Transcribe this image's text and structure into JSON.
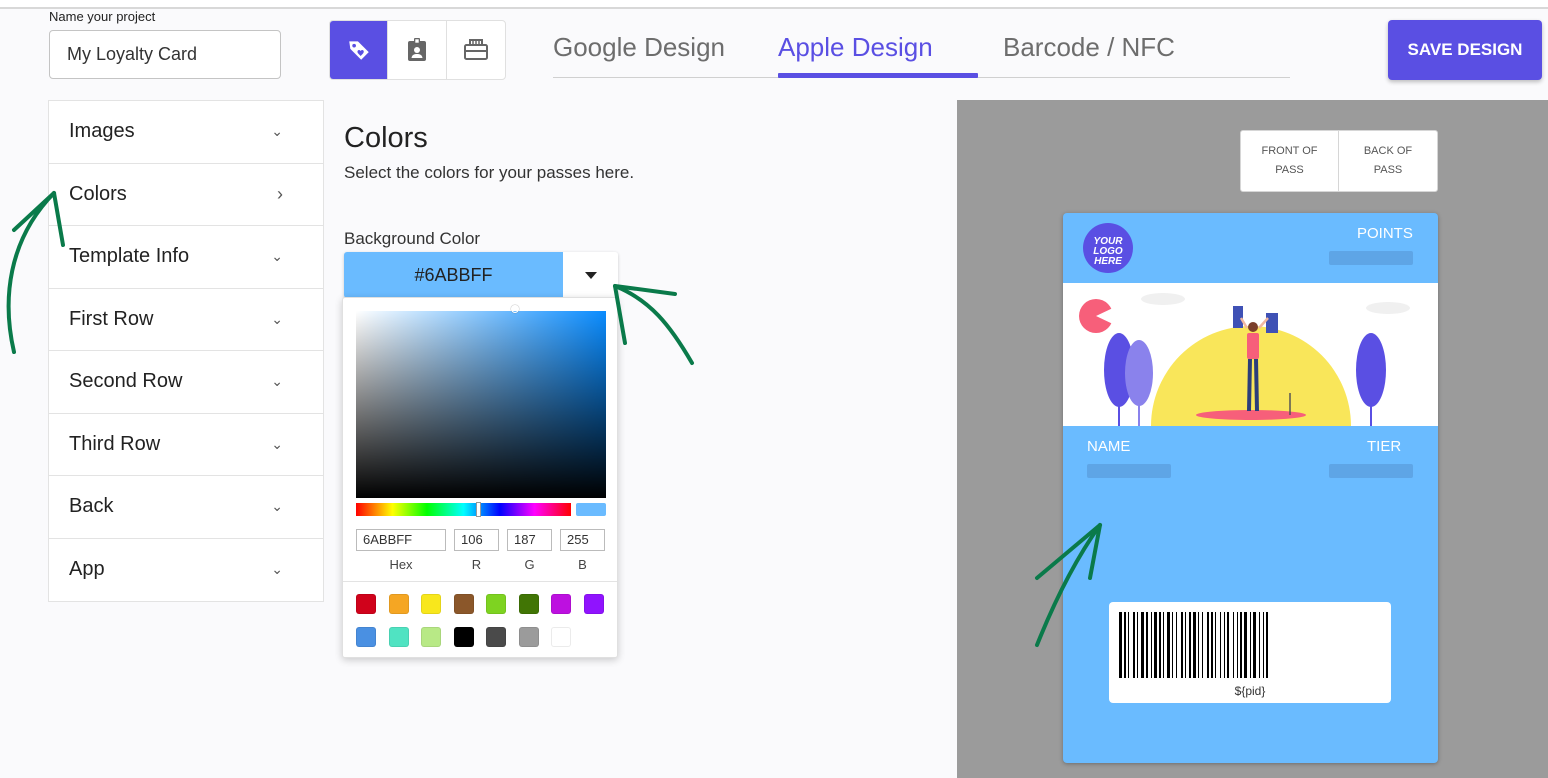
{
  "project": {
    "label": "Name your project",
    "value": "My Loyalty Card"
  },
  "icons": [
    {
      "name": "tag-icon",
      "active": true
    },
    {
      "name": "badge-icon",
      "active": false
    },
    {
      "name": "ticket-icon",
      "active": false
    }
  ],
  "tabs": [
    {
      "label": "Google Design",
      "active": false
    },
    {
      "label": "Apple Design",
      "active": true
    },
    {
      "label": "Barcode / NFC",
      "active": false
    }
  ],
  "save_label": "SAVE DESIGN",
  "sidebar": {
    "items": [
      {
        "label": "Images",
        "chevron": "down"
      },
      {
        "label": "Colors",
        "chevron": "right"
      },
      {
        "label": "Template Info",
        "chevron": "down"
      },
      {
        "label": "First Row",
        "chevron": "down"
      },
      {
        "label": "Second Row",
        "chevron": "down"
      },
      {
        "label": "Third Row",
        "chevron": "down"
      },
      {
        "label": "Back",
        "chevron": "down"
      },
      {
        "label": "App",
        "chevron": "down"
      }
    ]
  },
  "content": {
    "title": "Colors",
    "subtitle": "Select the colors for your passes here.",
    "field_label": "Background Color",
    "field_value": "#6ABBFF"
  },
  "picker": {
    "hex": "6ABBFF",
    "r": "106",
    "g": "187",
    "b": "255",
    "labels": {
      "hex": "Hex",
      "r": "R",
      "g": "G",
      "b": "B"
    },
    "swatches": [
      "#d0021b",
      "#f5a623",
      "#f8e71c",
      "#8b572a",
      "#7ed321",
      "#417505",
      "#bd10e0",
      "#9013fe",
      "#4a90e2",
      "#50e3c2",
      "#b8e986",
      "#000000",
      "#4a4a4a",
      "#9b9b9b",
      "#ffffff"
    ]
  },
  "preview": {
    "front_label": "FRONT OF PASS",
    "back_label": "BACK OF PASS",
    "logo_text": "YOUR LOGO HERE",
    "points_label": "POINTS",
    "name_label": "NAME",
    "tier_label": "TIER",
    "barcode_text": "${pid}"
  },
  "colors": {
    "accent": "#5a4fe3",
    "pass_bg": "#6abbff",
    "preview_bg": "#9b9b9b",
    "annotation": "#0a7a4a"
  }
}
